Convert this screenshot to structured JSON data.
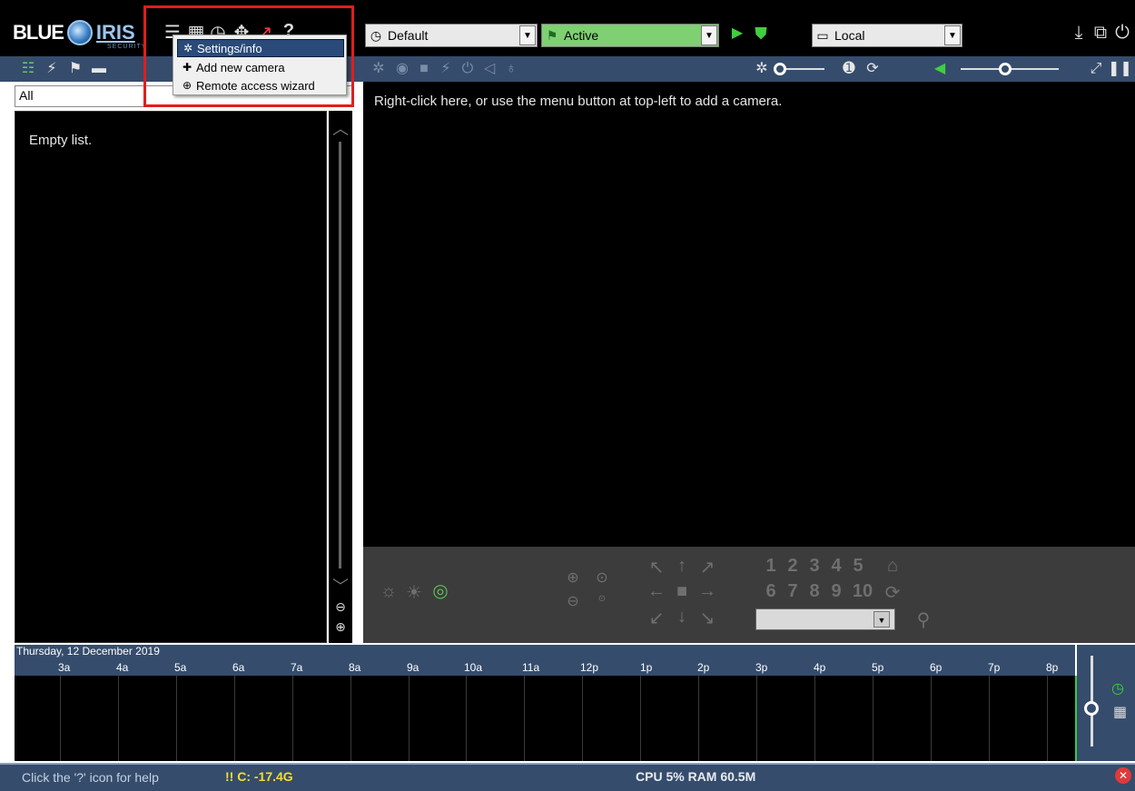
{
  "app": {
    "logo_left": "BLUE",
    "logo_right": "IRIS",
    "logo_sub": "SECURITY"
  },
  "toolbar": {
    "icons": [
      "menu-list-icon",
      "clapper-icon",
      "clock-icon",
      "move-icon",
      "chart-icon",
      "help-icon"
    ],
    "question": "?"
  },
  "profile_combo": {
    "value": "Default",
    "icon": "clock-icon"
  },
  "schedule_combo": {
    "value": "Active",
    "icon": "flag-icon"
  },
  "location_combo": {
    "value": "Local",
    "icon": "monitor-icon"
  },
  "popup_menu": {
    "items": [
      {
        "label": "Settings/info",
        "icon": "gear-icon",
        "selected": true
      },
      {
        "label": "Add new camera",
        "icon": "plus-icon",
        "selected": false
      },
      {
        "label": "Remote access wizard",
        "icon": "globe-icon",
        "selected": false
      }
    ]
  },
  "left_panel": {
    "filter_value": "All",
    "empty_text": "Empty list."
  },
  "main_view": {
    "hint": "Right-click here, or use the menu button at top-left to add a camera."
  },
  "ptz": {
    "presets_row1": [
      "1",
      "2",
      "3",
      "4",
      "5"
    ],
    "presets_row2": [
      "6",
      "7",
      "8",
      "9",
      "10"
    ]
  },
  "timeline": {
    "date": "Thursday, 12 December 2019",
    "ticks": [
      "3a",
      "4a",
      "5a",
      "6a",
      "7a",
      "8a",
      "9a",
      "10a",
      "11a",
      "12p",
      "1p",
      "2p",
      "3p",
      "4p",
      "5p",
      "6p",
      "7p",
      "8p"
    ]
  },
  "status": {
    "help": "Click the '?' icon for help",
    "disk": "!! C: -17.4G",
    "cpu": "CPU 5% RAM 60.5M"
  },
  "colors": {
    "accent": "#354c6c",
    "active_green": "#7fcf73",
    "warn": "#f3de33",
    "close_red": "#e03a3a",
    "highlight_box": "#e11d1d"
  }
}
